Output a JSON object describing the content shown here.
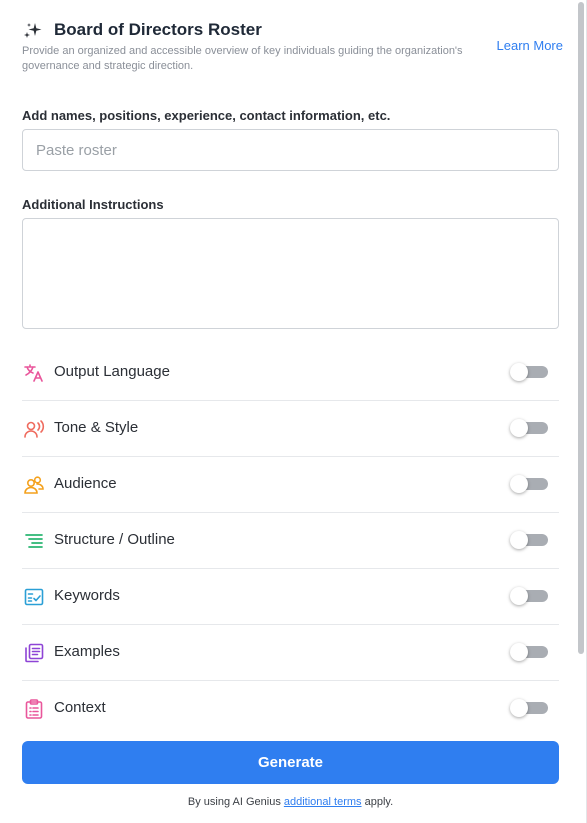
{
  "header": {
    "title": "Board of Directors Roster",
    "subtitle": "Provide an organized and accessible overview of key individuals guiding the organization's governance and strategic direction.",
    "learn_more": "Learn More",
    "icon": "sparkle-icon"
  },
  "roster": {
    "label": "Add names, positions, experience, contact information, etc.",
    "placeholder": "Paste roster",
    "value": ""
  },
  "instructions": {
    "label": "Additional Instructions",
    "value": ""
  },
  "options": [
    {
      "label": "Output Language",
      "icon": "translate-icon",
      "color": "#e9569b",
      "enabled": false
    },
    {
      "label": "Tone & Style",
      "icon": "voice-icon",
      "color": "#ef6b5e",
      "enabled": false
    },
    {
      "label": "Audience",
      "icon": "users-icon",
      "color": "#f4a11d",
      "enabled": false
    },
    {
      "label": "Structure / Outline",
      "icon": "outline-icon",
      "color": "#2bb673",
      "enabled": false
    },
    {
      "label": "Keywords",
      "icon": "checklist-icon",
      "color": "#2a9fd6",
      "enabled": false
    },
    {
      "label": "Examples",
      "icon": "documents-icon",
      "color": "#8e44d6",
      "enabled": false
    },
    {
      "label": "Context",
      "icon": "clipboard-icon",
      "color": "#e9569b",
      "enabled": false
    }
  ],
  "generate_label": "Generate",
  "terms": {
    "prefix": "By using AI Genius ",
    "link": "additional terms",
    "suffix": " apply."
  },
  "colors": {
    "accent": "#2f7ef0",
    "toggle_off": "#a9adb3"
  }
}
